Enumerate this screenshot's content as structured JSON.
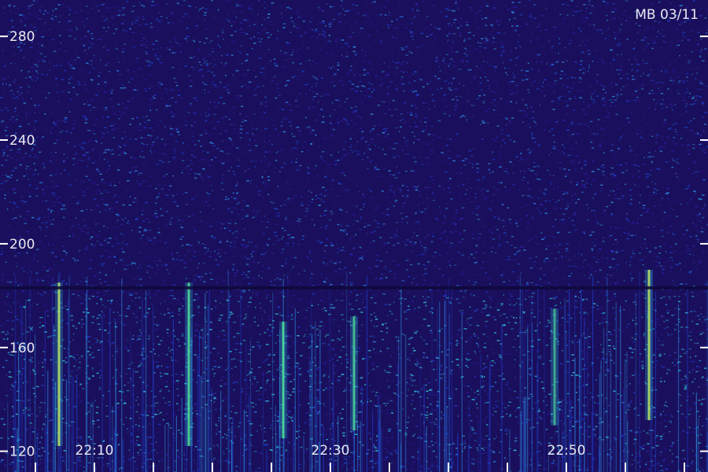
{
  "chart_data": {
    "type": "heatmap",
    "title": "MB 03/11",
    "xlabel": "",
    "ylabel": "",
    "y_ticks": [
      120,
      160,
      200,
      240,
      280
    ],
    "y_tick_labels": [
      "120",
      "160",
      "200",
      "240",
      "280"
    ],
    "x_ticks": [
      "22:10",
      "22:30",
      "22:50"
    ],
    "x_tick_minutes": [
      10,
      30,
      50
    ],
    "x_range_minutes": [
      2,
      62
    ],
    "y_range": [
      112,
      294
    ],
    "x_minor_tick_interval_minutes": 5,
    "grid": false,
    "colormap": [
      "#1a0f5c",
      "#2a1a9a",
      "#2040d0",
      "#2c8fe0",
      "#30d0e0",
      "#60f080",
      "#e0e040"
    ],
    "noise_floor_band": [
      112,
      294
    ],
    "strong_activity_band": [
      120,
      180
    ],
    "quiet_gap_frequency": 183,
    "bright_bursts": [
      {
        "time": "22:07",
        "low": 122,
        "high": 185,
        "intensity": 0.9
      },
      {
        "time": "22:18",
        "low": 122,
        "high": 185,
        "intensity": 0.8
      },
      {
        "time": "22:26",
        "low": 125,
        "high": 170,
        "intensity": 0.8
      },
      {
        "time": "22:32",
        "low": 128,
        "high": 172,
        "intensity": 0.7
      },
      {
        "time": "22:49",
        "low": 130,
        "high": 175,
        "intensity": 0.6
      },
      {
        "time": "22:57",
        "low": 132,
        "high": 190,
        "intensity": 0.9
      }
    ]
  },
  "colors": {
    "background": "#1a0f5c",
    "text": "#e8e8f0",
    "ticks": "#ffffff"
  }
}
